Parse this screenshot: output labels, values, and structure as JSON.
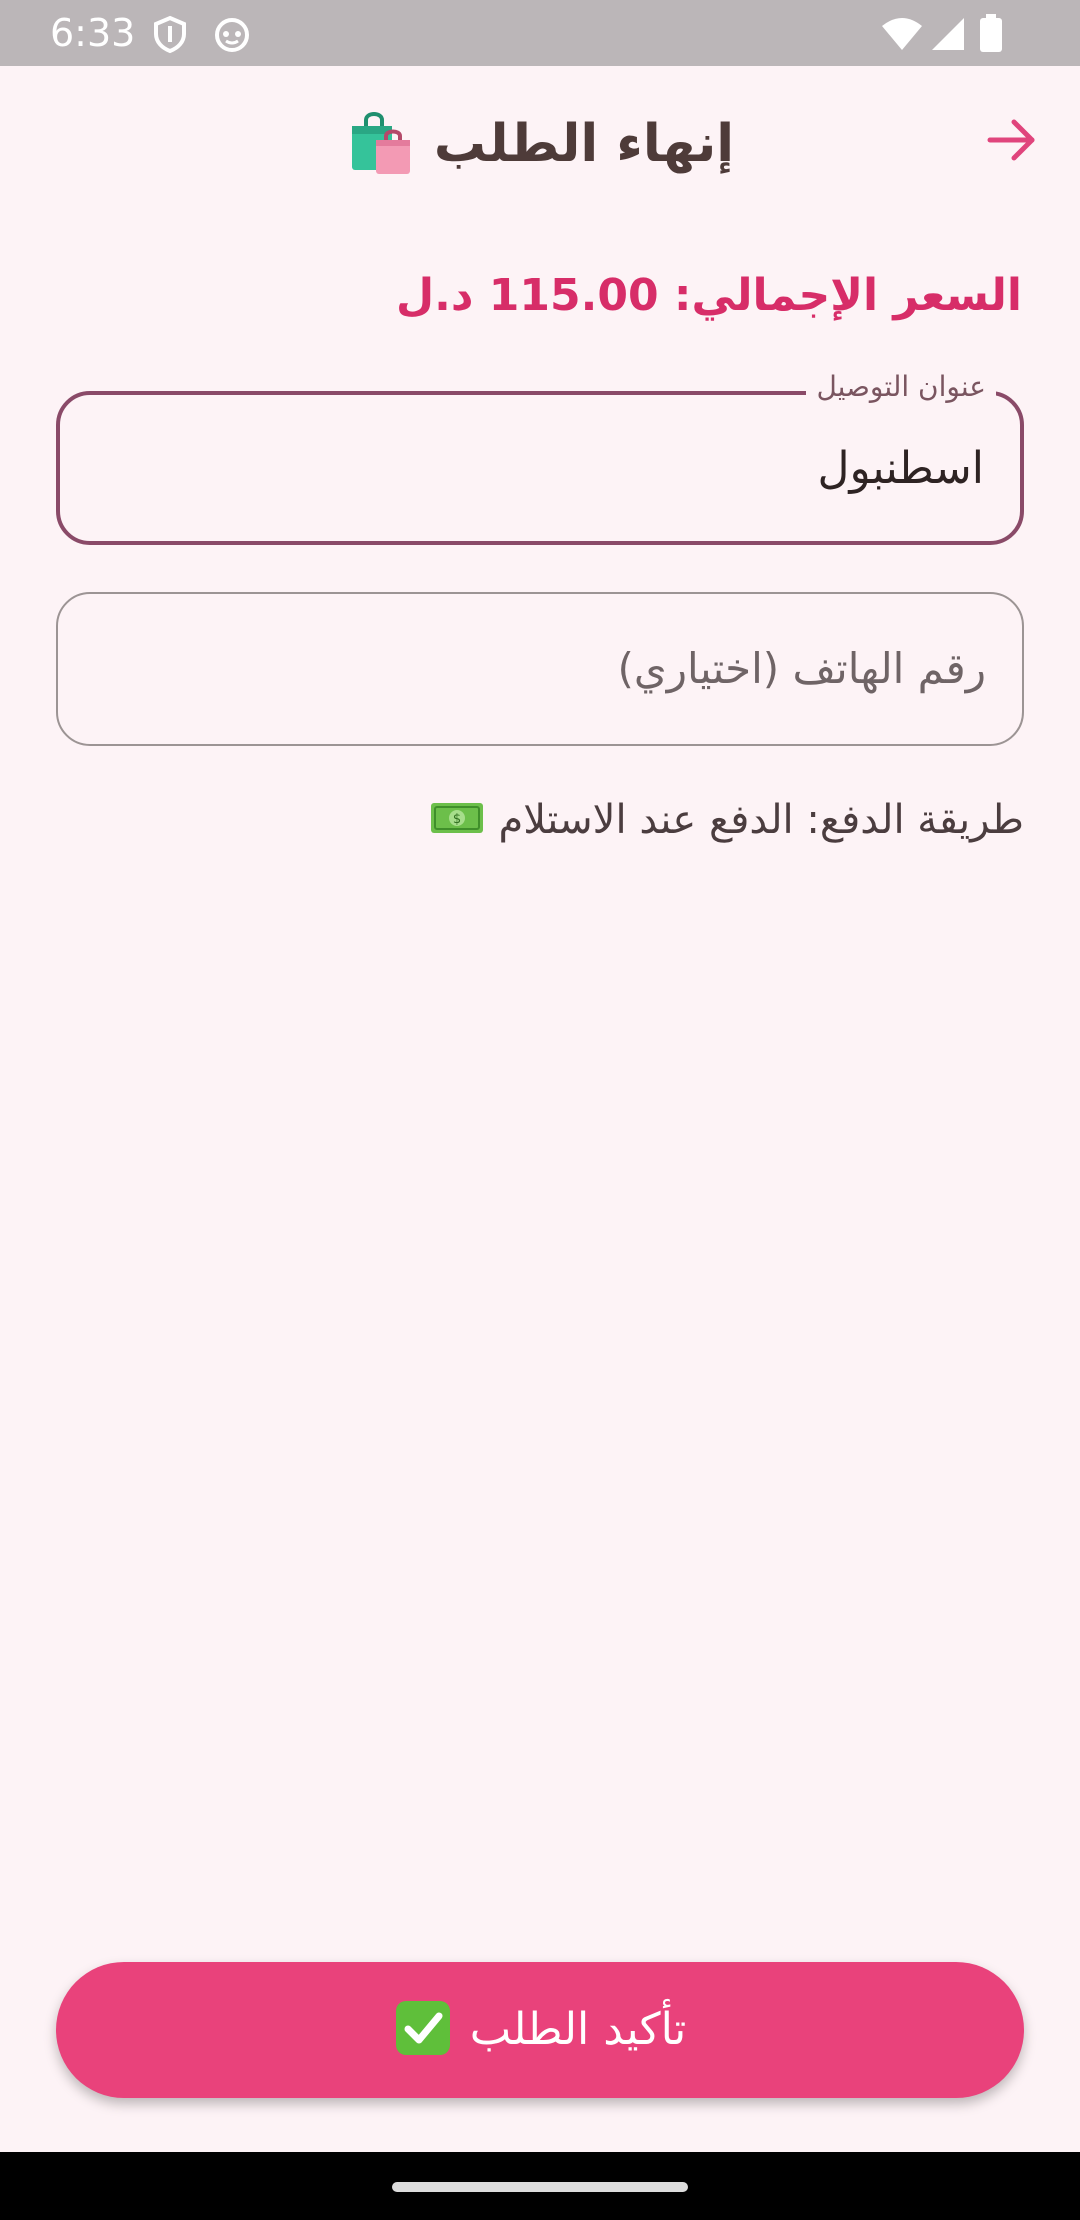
{
  "status_bar": {
    "time": "6:33"
  },
  "app_bar": {
    "title": "إنهاء الطلب",
    "title_icon": "shopping-bags-icon",
    "back_icon": "arrow-right-icon"
  },
  "summary": {
    "total_price": "السعر الإجمالي: 115.00 د.ل"
  },
  "form": {
    "address": {
      "label": "عنوان التوصيل",
      "value": "اسطنبول"
    },
    "phone": {
      "placeholder": "رقم الهاتف (اختياري)",
      "value": ""
    }
  },
  "payment": {
    "text": "طريقة الدفع: الدفع عند الاستلام",
    "icon": "money-icon"
  },
  "confirm_button": {
    "label": "تأكيد الطلب",
    "icon": "check-icon"
  },
  "colors": {
    "background": "#fdf3f6",
    "accent": "#e9427b",
    "price": "#d72d68",
    "title": "#4e3b39",
    "field_border_focused": "#8a4a68"
  }
}
